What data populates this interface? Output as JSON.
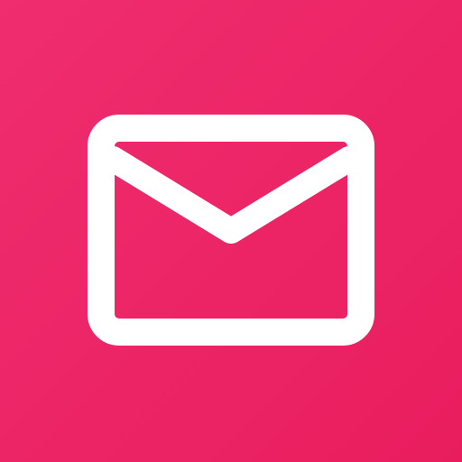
{
  "icon": {
    "name": "mail-icon",
    "background_start": "#ef2d6f",
    "background_end": "#e91d5e",
    "glyph_color": "#ffffff"
  }
}
